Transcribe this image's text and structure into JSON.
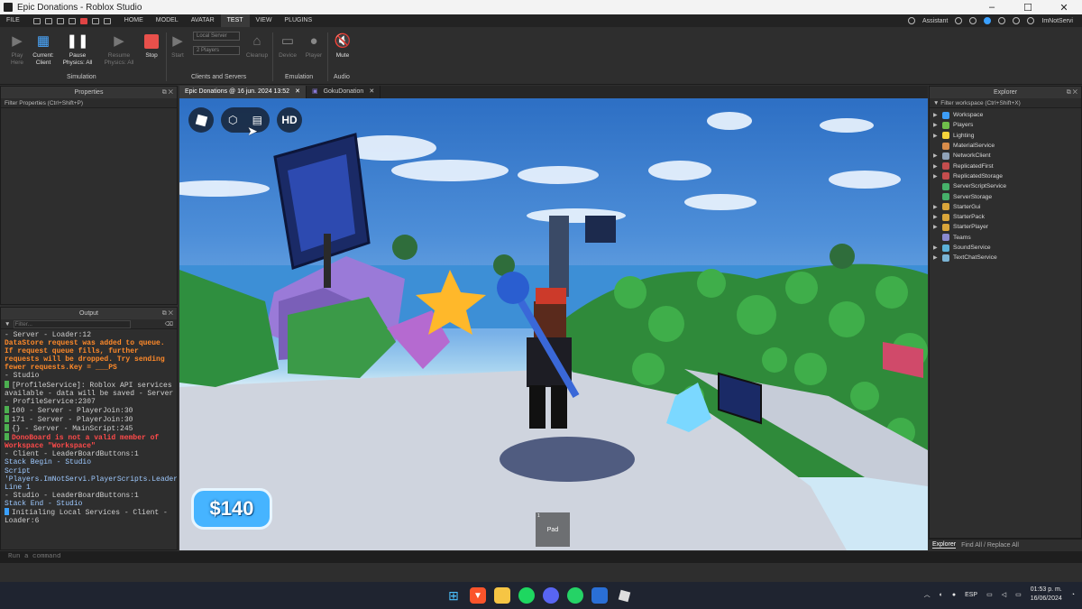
{
  "window": {
    "title": "Epic Donations - Roblox Studio"
  },
  "menu": {
    "file": "FILE",
    "tabs": [
      "HOME",
      "MODEL",
      "AVATAR",
      "TEST",
      "VIEW",
      "PLUGINS"
    ],
    "assistant": "Assistant",
    "user": "ImNotServi"
  },
  "ribbon": {
    "play": "Play\nHere",
    "current_client": "Current:\nClient",
    "pause_physics": "Pause\nPhysics: All",
    "resume_physics": "Resume\nPhysics: All",
    "stop": "Stop",
    "start": "Start",
    "local_server": "Local Server",
    "players_count": "2 Players",
    "cleanup": "Cleanup",
    "device": "Device",
    "player": "Player",
    "mute": "Mute",
    "groups": {
      "simulation": "Simulation",
      "clients_servers": "Clients and Servers",
      "emulation": "Emulation",
      "audio": "Audio"
    }
  },
  "properties": {
    "title": "Properties",
    "filter": "Filter Properties (Ctrl+Shift+P)"
  },
  "output": {
    "title": "Output",
    "filter_placeholder": "Filter...",
    "lines": [
      {
        "t": "  -  Server - Loader:12",
        "c": ""
      },
      {
        "t": "  DataStore request was added to queue. If request queue fills, further requests will be dropped. Try sending fewer requests.Key = ___PS",
        "c": "warn"
      },
      {
        "t": "  -  Studio",
        "c": ""
      },
      {
        "t": "[ProfileService]: Roblox API services available - data will be saved  -  Server - ProfileService:2307",
        "c": "",
        "m": "#4caf50"
      },
      {
        "t": "100  -  Server - PlayerJoin:30",
        "c": "",
        "m": "#4caf50"
      },
      {
        "t": "171  -  Server - PlayerJoin:30",
        "c": "",
        "m": "#4caf50"
      },
      {
        "t": "{}  -  Server - MainScript:245",
        "c": "",
        "m": "#4caf50"
      },
      {
        "t": "DonoBoard is not a valid member of Workspace \"Workspace\"",
        "c": "err",
        "m": "#4caf50"
      },
      {
        "t": "  -  Client - LeaderBoardButtons:1",
        "c": ""
      },
      {
        "t": "  Stack Begin  -  Studio",
        "c": "info"
      },
      {
        "t": "  Script 'Players.ImNotServi.PlayerScripts.LeaderBoardButtons', Line 1",
        "c": "info"
      },
      {
        "t": "  -  Studio - LeaderBoardButtons:1",
        "c": ""
      },
      {
        "t": "  Stack End  -  Studio",
        "c": "info"
      },
      {
        "t": "Initialing Local Services  -  Client - Loader:6",
        "c": "",
        "m": "#3aa0ff"
      }
    ]
  },
  "tabs": {
    "doc1": "Epic Donations @ 16 jun. 2024 13:52",
    "doc2": "GokuDonation"
  },
  "game": {
    "money": "$140",
    "pad_label": "Pad",
    "pad_number": "1",
    "hd": "HD"
  },
  "explorer": {
    "title": "Explorer",
    "filter": "Filter workspace (Ctrl+Shift+X)",
    "items": [
      {
        "name": "Workspace",
        "exp": true,
        "color": "#3d9df6"
      },
      {
        "name": "Players",
        "exp": true,
        "color": "#6fbf4a"
      },
      {
        "name": "Lighting",
        "exp": true,
        "color": "#f5d33b"
      },
      {
        "name": "MaterialService",
        "exp": false,
        "color": "#d88c4a"
      },
      {
        "name": "NetworkClient",
        "exp": true,
        "color": "#8fa2b8"
      },
      {
        "name": "ReplicatedFirst",
        "exp": true,
        "color": "#c44d4d"
      },
      {
        "name": "ReplicatedStorage",
        "exp": true,
        "color": "#c44d4d"
      },
      {
        "name": "ServerScriptService",
        "exp": false,
        "color": "#46b06a"
      },
      {
        "name": "ServerStorage",
        "exp": false,
        "color": "#46b06a"
      },
      {
        "name": "StarterGui",
        "exp": true,
        "color": "#d9a53a"
      },
      {
        "name": "StarterPack",
        "exp": true,
        "color": "#d9a53a"
      },
      {
        "name": "StarterPlayer",
        "exp": true,
        "color": "#d9a53a"
      },
      {
        "name": "Teams",
        "exp": false,
        "color": "#8a8ad0"
      },
      {
        "name": "SoundService",
        "exp": true,
        "color": "#5bb0d8"
      },
      {
        "name": "TextChatService",
        "exp": true,
        "color": "#7ab3d4"
      }
    ],
    "footer_tabs": [
      "Explorer",
      "Find All / Replace All"
    ]
  },
  "command": {
    "placeholder": "Run a command"
  },
  "taskbar": {
    "lang": "ESP",
    "time": "01:53 p. m.",
    "date": "16/06/2024"
  },
  "colors": {
    "accent": "#3aa0ff",
    "money_bg": "#46b4ff",
    "stop": "#e8504b"
  }
}
